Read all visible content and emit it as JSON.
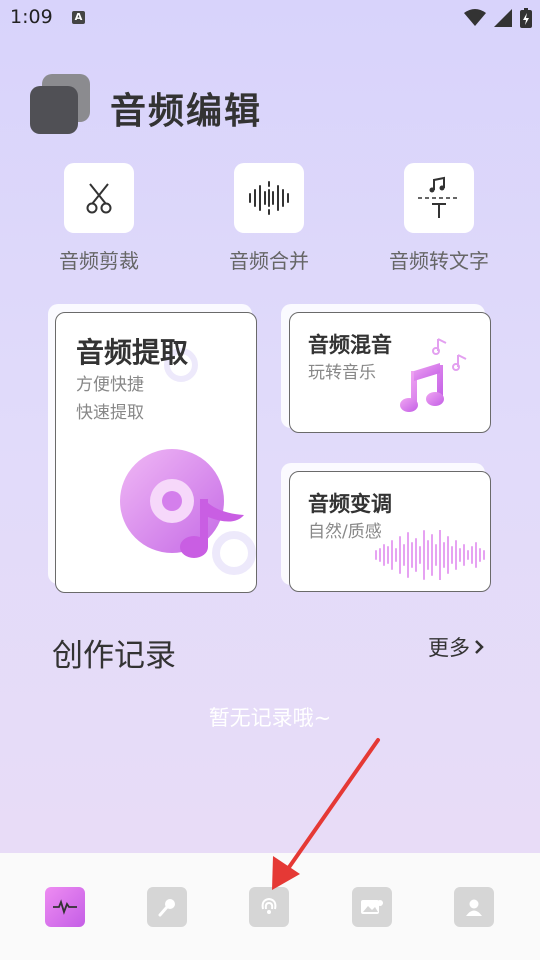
{
  "status": {
    "time": "1:09",
    "notice": "A"
  },
  "header": {
    "title": "音频编辑"
  },
  "tools": [
    {
      "label": "音频剪裁",
      "icon": "scissors-icon"
    },
    {
      "label": "音频合并",
      "icon": "waveform-icon"
    },
    {
      "label": "音频转文字",
      "icon": "music-text-icon"
    }
  ],
  "cards": {
    "extract": {
      "title": "音频提取",
      "sub1": "方便快捷",
      "sub2": "快速提取"
    },
    "mix": {
      "title": "音频混音",
      "sub": "玩转音乐"
    },
    "pitch": {
      "title": "音频变调",
      "sub": "自然/质感"
    }
  },
  "records": {
    "title": "创作记录",
    "more": "更多",
    "empty": "暂无记录哦~"
  },
  "nav": [
    {
      "name": "nav-audio-edit",
      "icon": "waveform-icon",
      "active": true
    },
    {
      "name": "nav-microphone",
      "icon": "microphone-icon",
      "active": false
    },
    {
      "name": "nav-listen",
      "icon": "ear-icon",
      "active": false
    },
    {
      "name": "nav-video",
      "icon": "image-icon",
      "active": false
    },
    {
      "name": "nav-profile",
      "icon": "user-icon",
      "active": false
    }
  ],
  "colors": {
    "accent": "#c45ee6",
    "arrow": "#e53935",
    "background": "#dcd7fa"
  }
}
